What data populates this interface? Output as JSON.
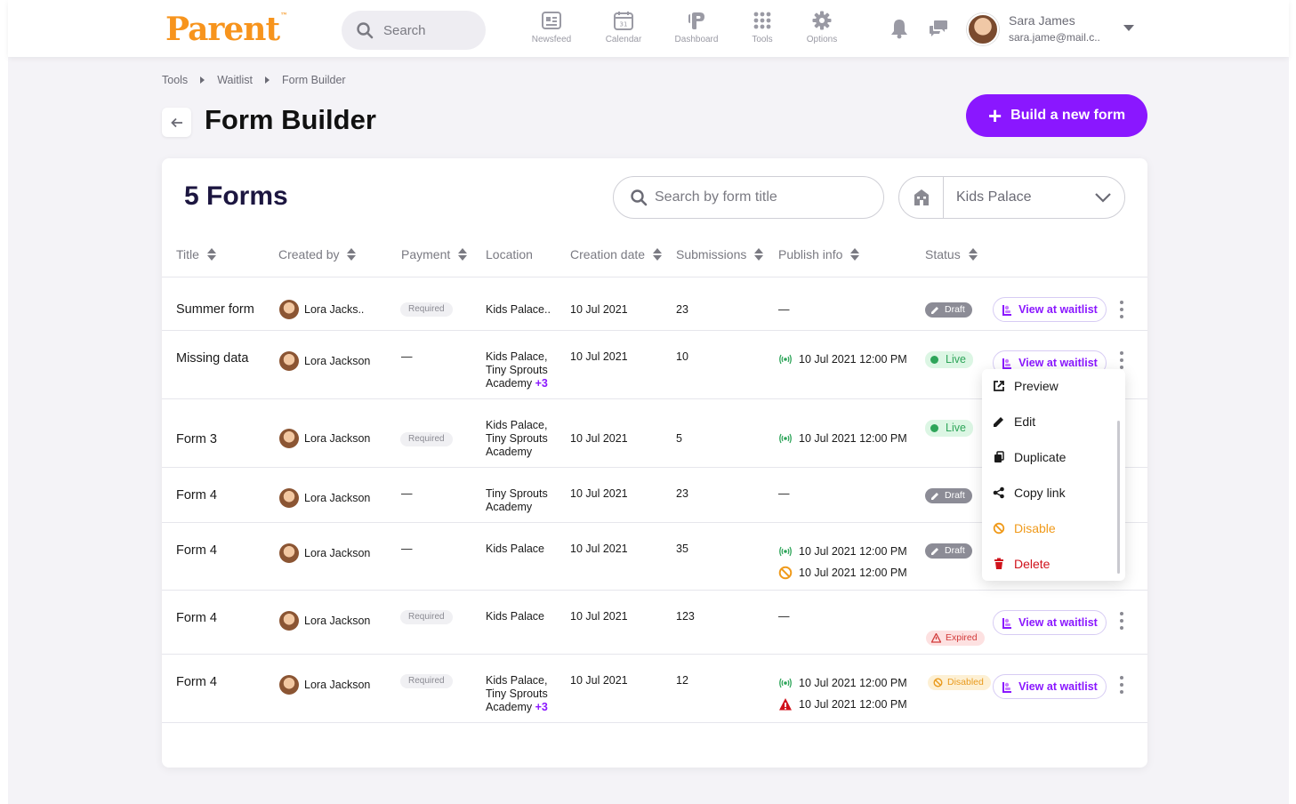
{
  "app": {
    "logo": "Parent",
    "logo_tm": "™"
  },
  "topbar": {
    "search_placeholder": "Search",
    "nav": [
      {
        "label": "Newsfeed",
        "icon": "newsfeed-icon"
      },
      {
        "label": "Calendar",
        "icon": "calendar-icon"
      },
      {
        "label": "Dashboard",
        "icon": "dashboard-icon"
      },
      {
        "label": "Tools",
        "icon": "tools-icon"
      },
      {
        "label": "Options",
        "icon": "options-icon"
      }
    ],
    "user": {
      "name": "Sara James",
      "email": "sara.jame@mail.c.."
    }
  },
  "breadcrumb": [
    "Tools",
    "Waitlist",
    "Form Builder"
  ],
  "page": {
    "title": "Form Builder",
    "build_button": "Build a new form"
  },
  "card": {
    "count_label": "5 Forms",
    "search_placeholder": "Search by form title",
    "location_selected": "Kids Palace"
  },
  "columns": [
    "Title",
    "Created by",
    "Payment",
    "Location",
    "Creation date",
    "Submissions",
    "Publish info",
    "Status"
  ],
  "rows": [
    {
      "title": "Summer form",
      "creator": "Lora Jacks..",
      "payment": "Required",
      "location": [
        "Kids Palace.."
      ],
      "location_more": "",
      "date": "10 Jul 2021",
      "submissions": "23",
      "publish": [
        {
          "type": "none",
          "text": "—"
        }
      ],
      "status": "Draft",
      "waitlist": "View at waitlist"
    },
    {
      "title": "Missing data",
      "creator": "Lora Jackson",
      "payment": "—",
      "location": [
        "Kids Palace,",
        "Tiny Sprouts",
        "Academy"
      ],
      "location_more": "+3",
      "date": "10 Jul 2021",
      "submissions": "10",
      "publish": [
        {
          "type": "live",
          "text": "10 Jul 2021 12:00 PM"
        }
      ],
      "status": "Live",
      "waitlist": "View at waitlist"
    },
    {
      "title": "Form 3",
      "creator": "Lora Jackson",
      "payment": "Required",
      "location": [
        "Kids Palace,",
        "Tiny Sprouts",
        "Academy"
      ],
      "location_more": "",
      "date": "10 Jul 2021",
      "submissions": "5",
      "publish": [
        {
          "type": "live",
          "text": "10 Jul 2021 12:00 PM"
        }
      ],
      "status": "Live",
      "waitlist": ""
    },
    {
      "title": "Form 4",
      "creator": "Lora Jackson",
      "payment": "—",
      "location": [
        "Tiny Sprouts",
        "Academy"
      ],
      "location_more": "",
      "date": "10 Jul 2021",
      "submissions": "23",
      "publish": [
        {
          "type": "none",
          "text": "—"
        }
      ],
      "status": "Draft",
      "waitlist": ""
    },
    {
      "title": "Form 4",
      "creator": "Lora Jackson",
      "payment": "—",
      "location": [
        "Kids Palace"
      ],
      "location_more": "",
      "date": "10 Jul 2021",
      "submissions": "35",
      "publish": [
        {
          "type": "live",
          "text": "10 Jul 2021 12:00 PM"
        },
        {
          "type": "disabled",
          "text": "10 Jul 2021 12:00 PM"
        }
      ],
      "status": "Draft",
      "waitlist": ""
    },
    {
      "title": "Form 4",
      "creator": "Lora Jackson",
      "payment": "Required",
      "location": [
        "Kids Palace"
      ],
      "location_more": "",
      "date": "10 Jul 2021",
      "submissions": "123",
      "publish": [
        {
          "type": "none",
          "text": "—"
        }
      ],
      "status": "Expired",
      "waitlist": "View at waitlist"
    },
    {
      "title": "Form 4",
      "creator": "Lora Jackson",
      "payment": "Required",
      "location": [
        "Kids Palace,",
        "Tiny Sprouts",
        "Academy"
      ],
      "location_more": "+3",
      "date": "10 Jul 2021",
      "submissions": "12",
      "publish": [
        {
          "type": "live",
          "text": "10 Jul 2021 12:00 PM"
        },
        {
          "type": "expired",
          "text": "10 Jul 2021 12:00 PM"
        }
      ],
      "status": "Disabled",
      "waitlist": "View at waitlist"
    }
  ],
  "context_menu": {
    "items": [
      {
        "label": "Preview",
        "icon": "external-link-icon",
        "color": "#1a1a1a"
      },
      {
        "label": "Edit",
        "icon": "pencil-icon",
        "color": "#1a1a1a"
      },
      {
        "label": "Duplicate",
        "icon": "copy-icon",
        "color": "#1a1a1a"
      },
      {
        "label": "Copy link",
        "icon": "share-icon",
        "color": "#1a1a1a"
      },
      {
        "label": "Disable",
        "icon": "block-icon",
        "color": "#f09a1a"
      },
      {
        "label": "Delete",
        "icon": "trash-icon",
        "color": "#d0121b"
      }
    ]
  },
  "colors": {
    "accent": "#8a17ff",
    "brand": "#f7941d",
    "live": "#2fa55a",
    "danger": "#d0121b",
    "warning": "#f09a1a"
  }
}
